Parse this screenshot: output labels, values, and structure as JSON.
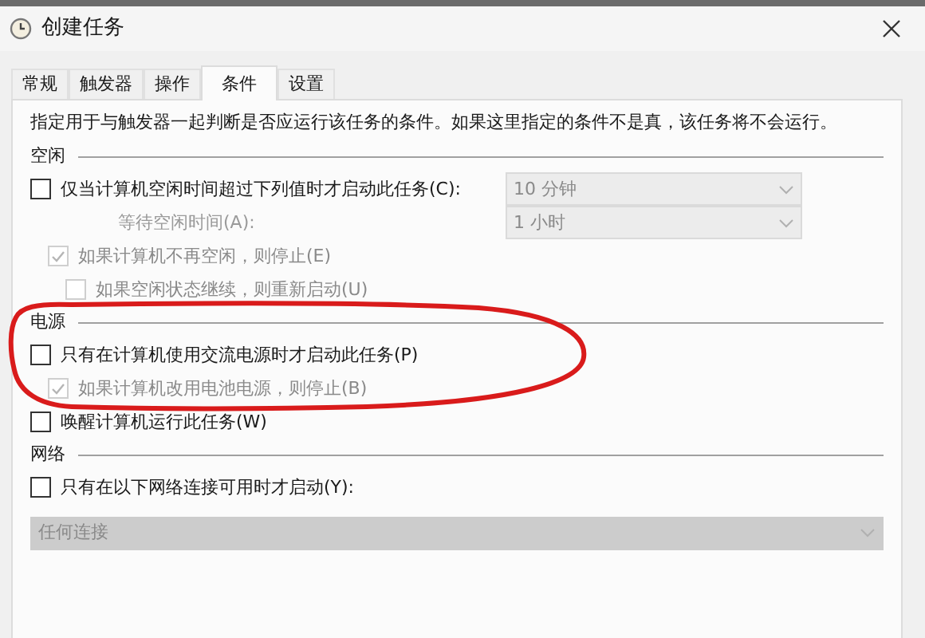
{
  "window": {
    "title": "创建任务"
  },
  "tabs": [
    {
      "label": "常规",
      "selected": false
    },
    {
      "label": "触发器",
      "selected": false
    },
    {
      "label": "操作",
      "selected": false
    },
    {
      "label": "条件",
      "selected": true
    },
    {
      "label": "设置",
      "selected": false
    }
  ],
  "description": "指定用于与触发器一起判断是否应运行该任务的条件。如果这里指定的条件不是真，该任务将不会运行。",
  "sections": [
    {
      "heading": "空闲",
      "items": [
        {
          "kind": "checkbox",
          "label": "仅当计算机空闲时间超过下列值时才启动此任务(C):",
          "checked": false,
          "disabled": false,
          "dropdown": {
            "value": "10 分钟",
            "disabled": true
          },
          "children": [
            {
              "kind": "label-dropdown",
              "label": "等待空闲时间(A):",
              "disabled": true,
              "dropdown": {
                "value": "1 小时",
                "disabled": true
              }
            },
            {
              "kind": "checkbox",
              "label": "如果计算机不再空闲，则停止(E)",
              "checked": true,
              "disabled": true,
              "children": [
                {
                  "kind": "checkbox",
                  "label": "如果空闲状态继续，则重新启动(U)",
                  "checked": false,
                  "disabled": true
                }
              ]
            }
          ]
        }
      ]
    },
    {
      "heading": "电源",
      "items": [
        {
          "kind": "checkbox",
          "label": "只有在计算机使用交流电源时才启动此任务(P)",
          "checked": false,
          "disabled": false,
          "children": [
            {
              "kind": "checkbox",
              "label": "如果计算机改用电池电源，则停止(B)",
              "checked": true,
              "disabled": true
            }
          ]
        },
        {
          "kind": "checkbox",
          "label": "唤醒计算机运行此任务(W)",
          "checked": false,
          "disabled": false
        }
      ]
    },
    {
      "heading": "网络",
      "items": [
        {
          "kind": "checkbox",
          "label": "只有在以下网络连接可用时才启动(Y):",
          "checked": false,
          "disabled": false
        },
        {
          "kind": "wide-dropdown",
          "dropdown": {
            "value": "任何连接",
            "disabled": true
          }
        }
      ]
    }
  ]
}
